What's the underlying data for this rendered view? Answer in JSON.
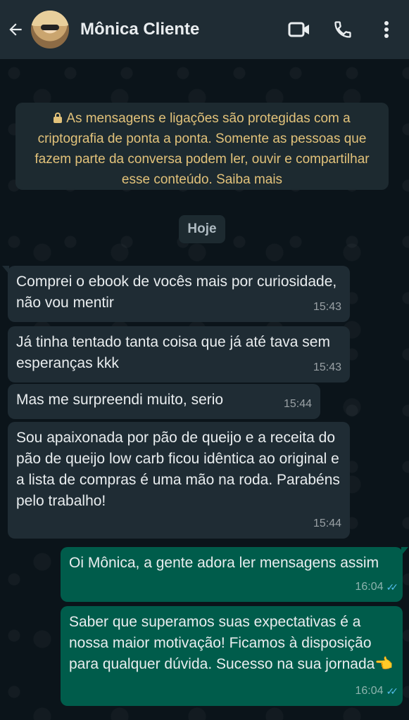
{
  "header": {
    "contact_name": "Mônica Cliente"
  },
  "encryption_notice": {
    "text": "As mensagens e ligações são protegidas com a criptografia de ponta a ponta. Somente as pessoas que fazem parte da conversa podem ler, ouvir e compartilhar esse conteúdo. Saiba mais"
  },
  "date_chip": "Hoje",
  "messages": [
    {
      "direction": "in",
      "text": "Comprei o ebook de vocês mais por curiosidade, não vou mentir",
      "time": "15:43"
    },
    {
      "direction": "in",
      "text": "Já tinha tentado tanta coisa que já até tava sem esperanças kkk",
      "time": "15:43"
    },
    {
      "direction": "in",
      "text": "Mas me surpreendi muito, serio",
      "time": "15:44"
    },
    {
      "direction": "in",
      "text": "Sou apaixonada por pão de queijo e a receita do pão de queijo low carb ficou idêntica ao original e a lista de compras é uma mão na roda. Parabéns pelo trabalho!",
      "time": "15:44"
    },
    {
      "direction": "out",
      "text": "Oi Mônica, a gente adora ler mensagens assim",
      "time": "16:04"
    },
    {
      "direction": "out",
      "text": "Saber que superamos suas expectativas é a nossa maior motivação! Ficamos à disposição para qualquer dúvida. Sucesso na sua jornada👈",
      "time": "16:04"
    }
  ]
}
